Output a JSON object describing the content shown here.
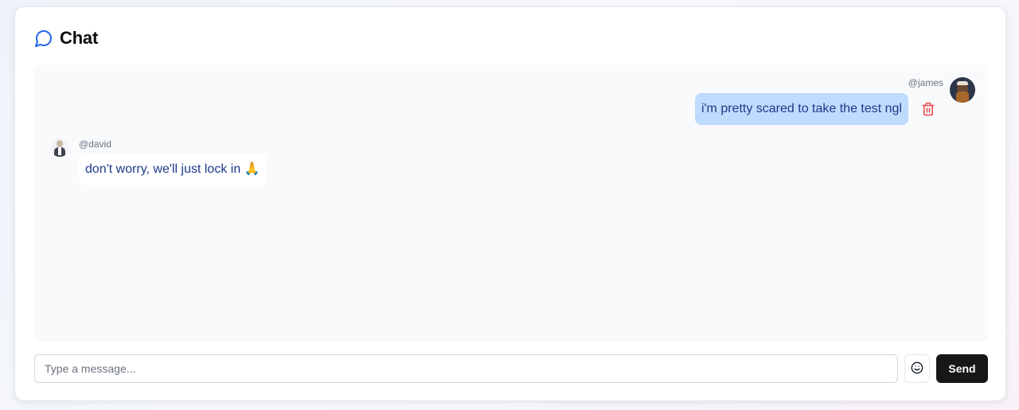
{
  "header": {
    "title": "Chat",
    "icon": "message-circle-icon",
    "accent_color": "#2563eb"
  },
  "messages": [
    {
      "direction": "outgoing",
      "username": "@james",
      "text": "i'm pretty scared to take the test ngl",
      "bubble_color": "#bfdbfe",
      "text_color": "#1e3a8a",
      "action_icon": "trash-icon",
      "action_color": "#ef4444"
    },
    {
      "direction": "incoming",
      "username": "@david",
      "text": "don't worry, we'll just lock in 🙏",
      "bubble_color": "#ffffff",
      "text_color": "#1e3a8a"
    }
  ],
  "composer": {
    "placeholder": "Type a message...",
    "value": "",
    "emoji_icon": "smile-icon",
    "send_label": "Send"
  }
}
